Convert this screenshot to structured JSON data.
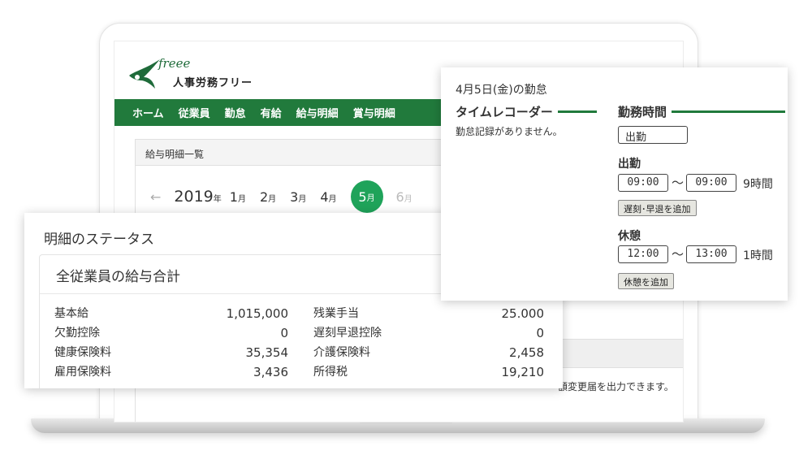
{
  "logo": {
    "script": "freee",
    "subtitle": "人事労務フリー"
  },
  "nav": [
    "ホーム",
    "従業員",
    "勤怠",
    "有給",
    "給与明細",
    "賞与明細"
  ],
  "payslip_list": {
    "title": "給与明細一覧",
    "year": "2019",
    "year_unit": "年",
    "month_unit": "月",
    "months": [
      "1",
      "2",
      "3",
      "4",
      "5",
      "6"
    ],
    "active_month": "5",
    "notice": "額変更届を出力できます。"
  },
  "status": {
    "title": "明細のステータス",
    "card_title": "全従業員の給与合計",
    "left_rows": [
      {
        "label": "基本給",
        "value": "1,015,000"
      },
      {
        "label": "欠勤控除",
        "value": "0"
      },
      {
        "label": "健康保険料",
        "value": "35,354"
      },
      {
        "label": "雇用保険料",
        "value": "3,436"
      }
    ],
    "right_rows": [
      {
        "label": "残業手当",
        "value": "25.000"
      },
      {
        "label": "遅刻早退控除",
        "value": "0"
      },
      {
        "label": "介護保険料",
        "value": "2,458"
      },
      {
        "label": "所得税",
        "value": "19,210"
      }
    ]
  },
  "attendance": {
    "date_heading": "4月5日(金)の勤怠",
    "time_recorder_title": "タイムレコーダー",
    "time_recorder_empty": "勤怠記録がありません。",
    "work_time_title": "勤務時間",
    "work_type": "出勤",
    "shift_label": "出勤",
    "shift_start": "09:00",
    "shift_end": "09:00",
    "shift_duration": "9時間",
    "late_early_button": "遅刻･早退を追加",
    "break_label": "休憩",
    "break_start": "12:00",
    "break_end": "13:00",
    "break_duration": "1時間",
    "add_break_button": "休憩を追加",
    "tilde": "〜"
  },
  "colors": {
    "brand_green": "#217a3c",
    "active_month": "#1fa35a"
  }
}
